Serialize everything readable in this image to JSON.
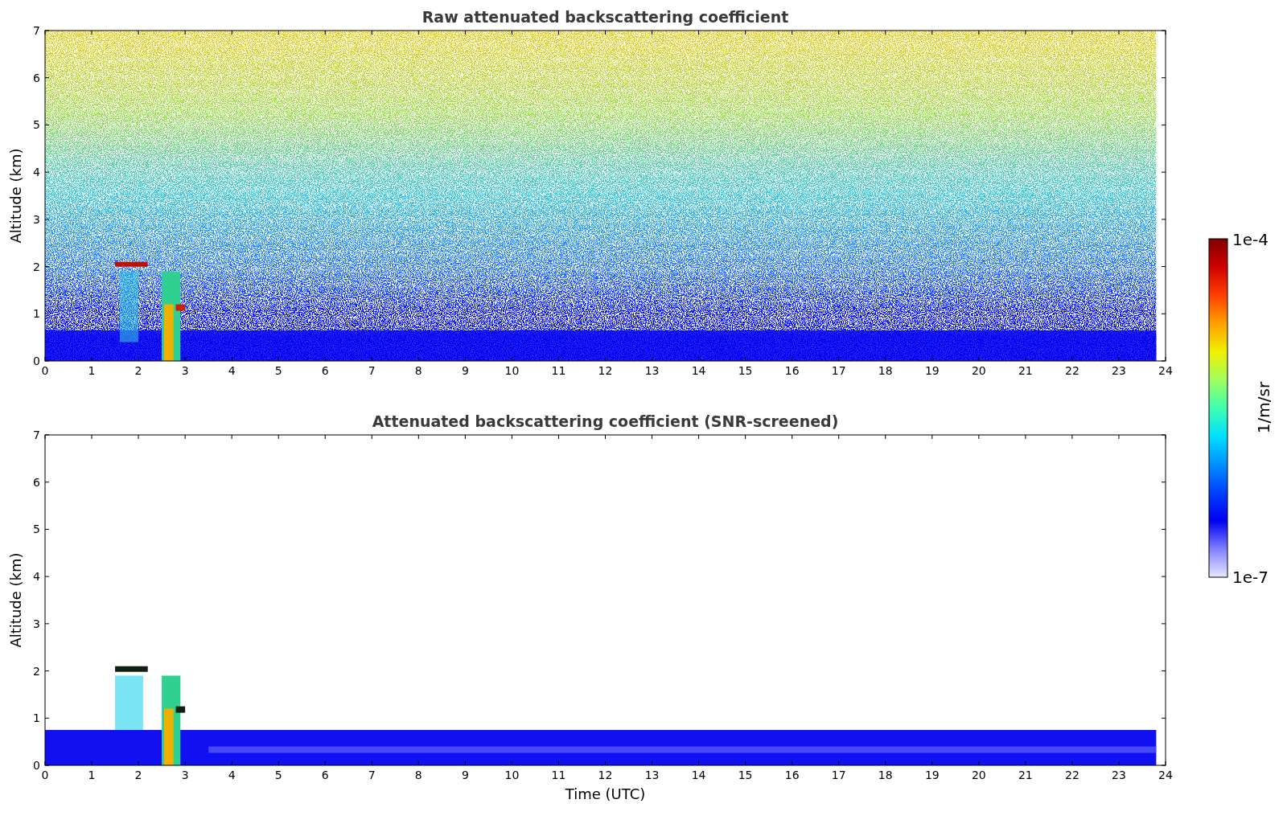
{
  "figure": {
    "panels": [
      {
        "kind": "raw",
        "title": "Raw attenuated backscattering coefficient",
        "ylabel": "Altitude (km)",
        "xticks": [
          "0",
          "1",
          "2",
          "3",
          "4",
          "5",
          "6",
          "7",
          "8",
          "9",
          "10",
          "11",
          "12",
          "13",
          "14",
          "15",
          "16",
          "17",
          "18",
          "19",
          "20",
          "21",
          "22",
          "23",
          "24"
        ],
        "yticks": [
          "7",
          "6",
          "5",
          "4",
          "3",
          "2",
          "1",
          "0"
        ]
      },
      {
        "kind": "screened",
        "title": "Attenuated backscattering coefficient (SNR-screened)",
        "ylabel": "Altitude (km)",
        "xlabel": "Time (UTC)",
        "xticks": [
          "0",
          "1",
          "2",
          "3",
          "4",
          "5",
          "6",
          "7",
          "8",
          "9",
          "10",
          "11",
          "12",
          "13",
          "14",
          "15",
          "16",
          "17",
          "18",
          "19",
          "20",
          "21",
          "22",
          "23",
          "24"
        ],
        "yticks": [
          "7",
          "6",
          "5",
          "4",
          "3",
          "2",
          "1",
          "0"
        ]
      }
    ],
    "colorbar": {
      "label": "1/m/sr",
      "max_label": "1e-4",
      "min_label": "1e-7"
    }
  }
}
